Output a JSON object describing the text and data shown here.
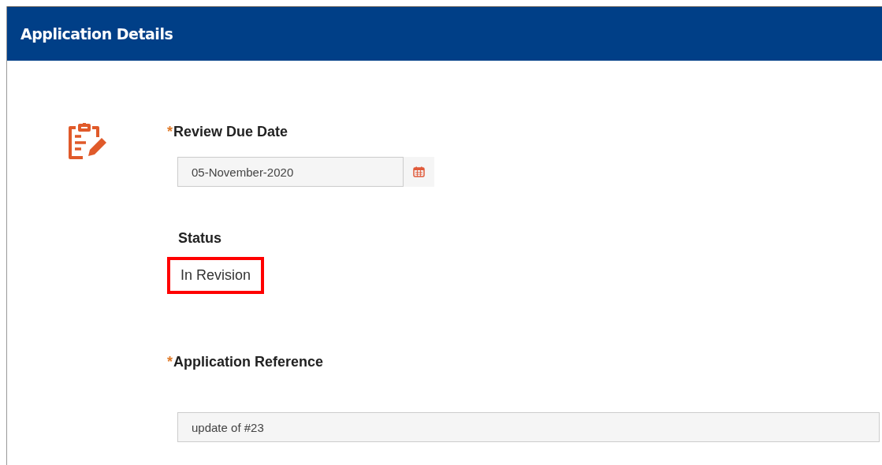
{
  "header": {
    "title": "Application Details"
  },
  "fields": [
    {
      "kind": "date",
      "required_mark": "*",
      "label": "Review Due Date",
      "value": "05-November-2020"
    },
    {
      "kind": "text",
      "label": "Status",
      "value": "In Revision",
      "highlighted": true
    },
    {
      "kind": "input",
      "required_mark": "*",
      "label": "Application Reference",
      "value": "update of #23"
    }
  ]
}
